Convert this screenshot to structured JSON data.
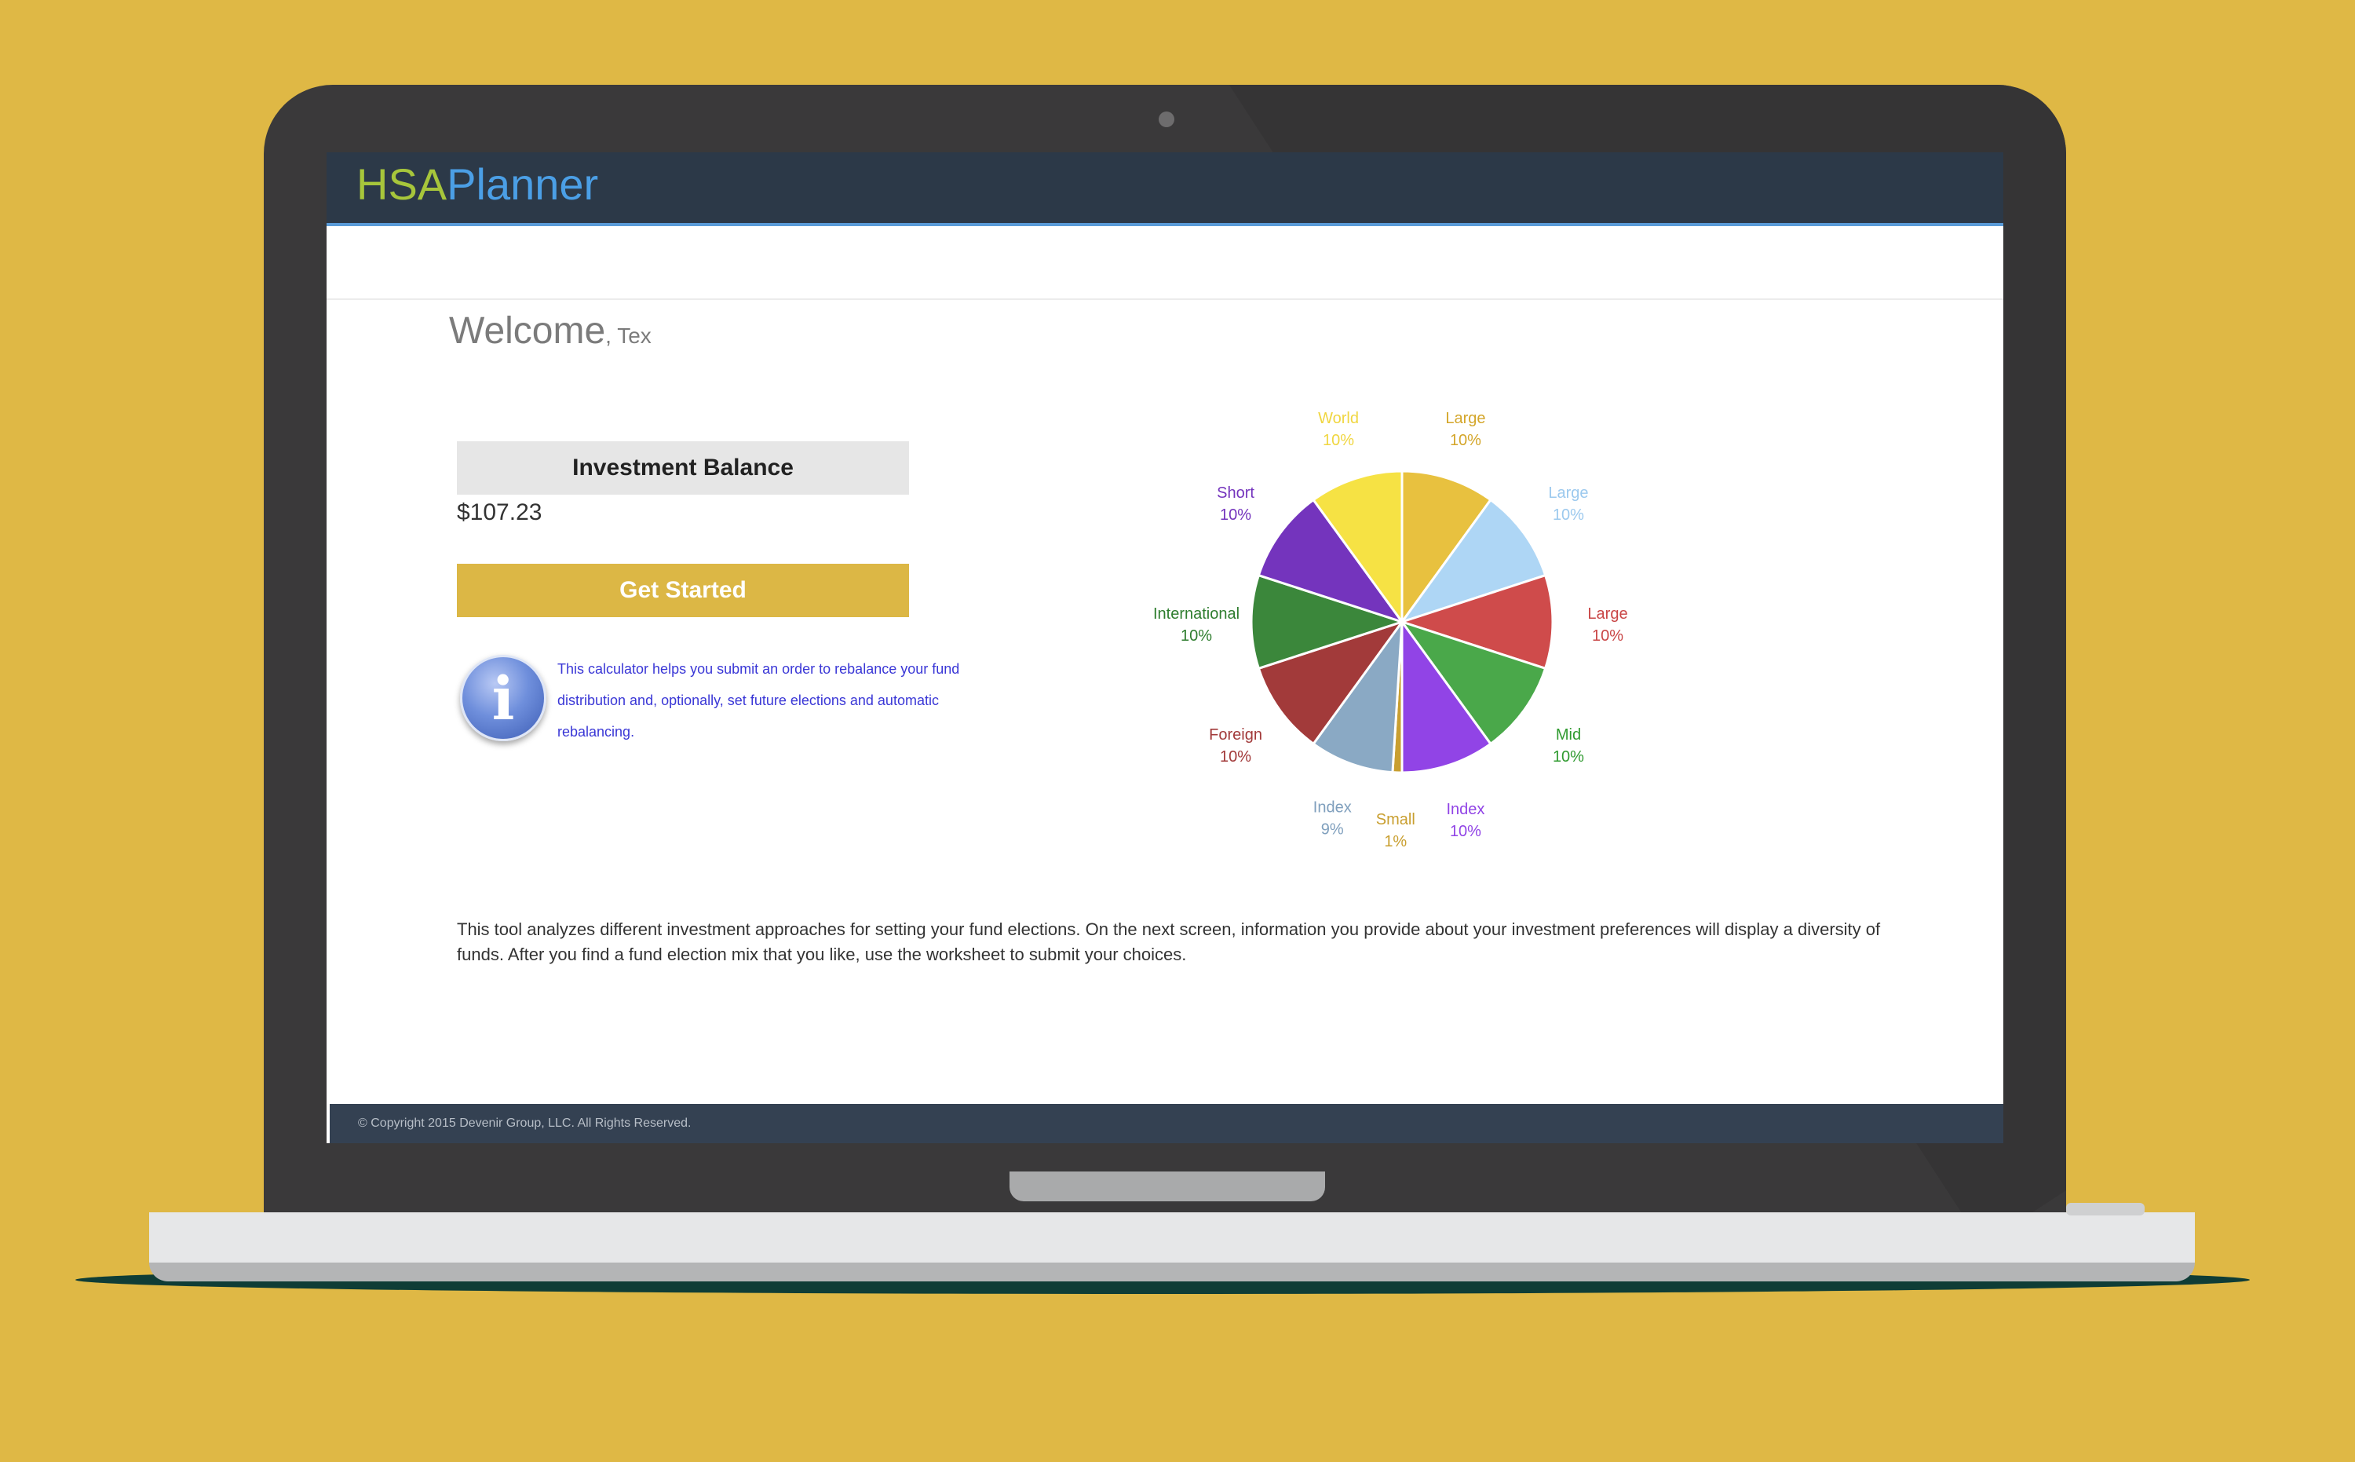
{
  "app": {
    "logo_part1": "HSA",
    "logo_part2": "Planner",
    "welcome": "Welcome",
    "user_name": ", Tex"
  },
  "balance": {
    "label": "Investment Balance",
    "value": "$107.23"
  },
  "actions": {
    "get_started": "Get Started"
  },
  "info": {
    "text": "This calculator helps you submit an order to rebalance your fund distribution and, optionally, set future elections and automatic rebalancing."
  },
  "description": "This tool analyzes different investment approaches for setting your fund elections. On the next screen, information you provide about your investment preferences will display a diversity of funds. After you find a fund election mix that you like, use the worksheet to submit your choices.",
  "footer": {
    "copyright": "© Copyright 2015 Devenir Group, LLC. All Rights Reserved."
  },
  "chart_data": {
    "type": "pie",
    "slices": [
      {
        "label": "Large",
        "pct_label": "10%",
        "value": 10,
        "color": "#e8c13f"
      },
      {
        "label": "Large",
        "pct_label": "10%",
        "value": 10,
        "color": "#aed6f5"
      },
      {
        "label": "Large",
        "pct_label": "10%",
        "value": 10,
        "color": "#cf4b4b"
      },
      {
        "label": "Mid",
        "pct_label": "10%",
        "value": 10,
        "color": "#4aa84a"
      },
      {
        "label": "Index",
        "pct_label": "10%",
        "value": 10,
        "color": "#9144e6"
      },
      {
        "label": "Small",
        "pct_label": "1%",
        "value": 1,
        "color": "#c99f30"
      },
      {
        "label": "Index",
        "pct_label": "9%",
        "value": 9,
        "color": "#8aa9c4"
      },
      {
        "label": "Foreign",
        "pct_label": "10%",
        "value": 10,
        "color": "#a23a3a"
      },
      {
        "label": "International",
        "pct_label": "10%",
        "value": 10,
        "color": "#3b873b"
      },
      {
        "label": "Short",
        "pct_label": "10%",
        "value": 10,
        "color": "#7434bd"
      },
      {
        "label": "World",
        "pct_label": "10%",
        "value": 10,
        "color": "#f6e244"
      }
    ],
    "label_colors": [
      "#d4a62a",
      "#9cc9ee",
      "#c94646",
      "#2f9a2f",
      "#9144e6",
      "#c99f30",
      "#7f9fbd",
      "#a23a3a",
      "#2e7d2e",
      "#7434bd",
      "#f0d640"
    ]
  }
}
